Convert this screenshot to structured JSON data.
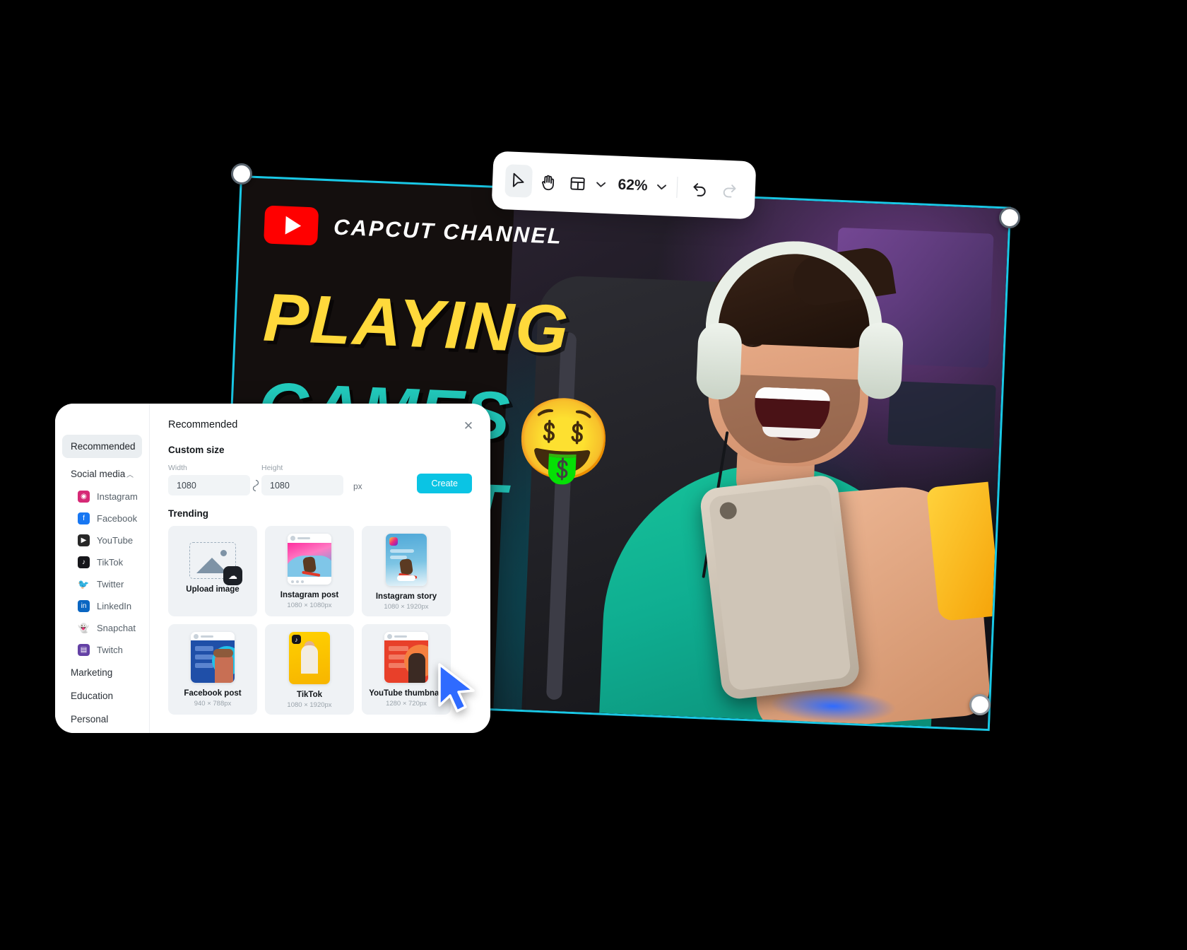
{
  "toolbar": {
    "tools": [
      {
        "name": "select-tool",
        "icon": "cursor-arrow-icon",
        "active": true
      },
      {
        "name": "hand-tool",
        "icon": "hand-icon",
        "active": false
      },
      {
        "name": "layout-tool",
        "icon": "layout-grid-icon",
        "active": false
      }
    ],
    "layout_caret": "chevron-down-icon",
    "zoom_level": "62%",
    "zoom_caret": "chevron-down-icon",
    "undo_icon": "undo-arrow-icon",
    "redo_icon": "redo-arrow-icon"
  },
  "canvas": {
    "channel_name": "CAPCUT CHANNEL",
    "logo_icon": "youtube-play-icon",
    "headline_line1": "PLAYING",
    "headline_line2": "GAMES",
    "headline_line3": "CUT",
    "emoji": "🤑",
    "selection_color": "#19c8e6",
    "accent_yellow": "#ffd93b",
    "accent_teal": "#22cbbd",
    "logo_red": "#ff0000"
  },
  "panel": {
    "header_title": "Recommended",
    "close_icon": "close-icon",
    "sidebar": {
      "active_item": "Recommended",
      "group_label": "Social media",
      "group_caret": "chevron-up-icon",
      "items": [
        {
          "label": "Instagram",
          "icon": "instagram-icon",
          "color": "#d62976"
        },
        {
          "label": "Facebook",
          "icon": "facebook-icon",
          "color": "#1877f2"
        },
        {
          "label": "YouTube",
          "icon": "youtube-icon",
          "color": "#282828"
        },
        {
          "label": "TikTok",
          "icon": "tiktok-icon",
          "color": "#16161a"
        },
        {
          "label": "Twitter",
          "icon": "twitter-icon",
          "color": "#1d9bf0"
        },
        {
          "label": "LinkedIn",
          "icon": "linkedin-icon",
          "color": "#0a66c2"
        },
        {
          "label": "Snapchat",
          "icon": "snapchat-icon",
          "color": "#5a6672"
        },
        {
          "label": "Twitch",
          "icon": "twitch-icon",
          "color": "#6441a5"
        }
      ],
      "categories": [
        "Marketing",
        "Education",
        "Personal"
      ]
    },
    "custom_size": {
      "section_label": "Custom size",
      "width_label": "Width",
      "width_value": "1080",
      "link_icon": "link-lock-icon",
      "height_label": "Height",
      "height_value": "1080",
      "unit": "px",
      "create_label": "Create",
      "create_color": "#0ac4e4"
    },
    "trending": {
      "section_label": "Trending",
      "cards": [
        {
          "title": "Upload image",
          "size": "",
          "thumb": "upload-placeholder",
          "badge_icon": "cloud-upload-icon"
        },
        {
          "title": "Instagram post",
          "size": "1080 × 1080px",
          "thumb": "instagram-post-preview"
        },
        {
          "title": "Instagram story",
          "size": "1080 × 1920px",
          "thumb": "instagram-story-preview"
        },
        {
          "title": "Facebook post",
          "size": "940 × 788px",
          "thumb": "facebook-post-preview"
        },
        {
          "title": "TikTok",
          "size": "1080 × 1920px",
          "thumb": "tiktok-preview"
        },
        {
          "title": "YouTube thumbnail",
          "size": "1280 × 720px",
          "thumb": "youtube-thumbnail-preview"
        }
      ]
    }
  }
}
